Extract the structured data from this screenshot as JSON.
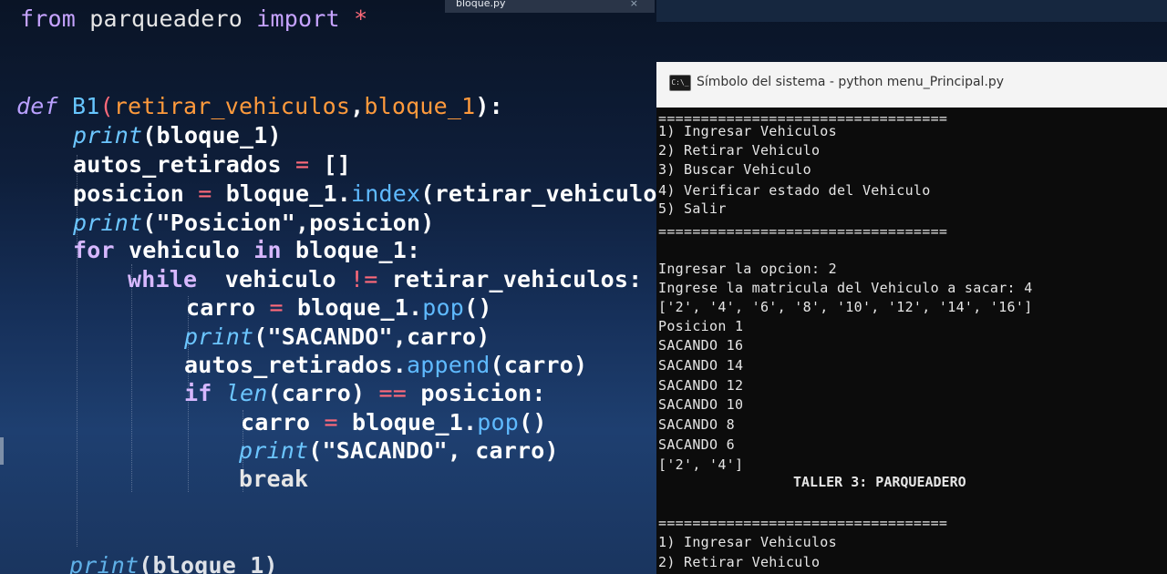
{
  "editor": {
    "tab_label": "bloque.py",
    "tab_close": "×",
    "code": {
      "l1": {
        "a": "from",
        "b": " parqueadero ",
        "c": "import",
        "d": " *"
      },
      "l2": {
        "a": "def",
        "b": " B1",
        "c": "(",
        "d": "retirar_vehiculos",
        "e": ",",
        "f": "bloque_1",
        "g": "):"
      },
      "l3": {
        "a": "print",
        "b": "(bloque_1)"
      },
      "l4": {
        "a": "autos_retirados ",
        "b": "=",
        "c": " []"
      },
      "l5": {
        "a": "posicion ",
        "b": "=",
        "c": " bloque_1.",
        "d": "index",
        "e": "(retirar_vehiculos"
      },
      "l6": {
        "a": "print",
        "b": "(\"Posicion\",posicion)"
      },
      "l7": {
        "a": "for",
        "b": " vehiculo ",
        "c": "in",
        "d": " bloque_1:"
      },
      "l8": {
        "a": "while",
        "b": "  vehiculo ",
        "c": "!=",
        "d": " retirar_vehiculos:"
      },
      "l9": {
        "a": "carro ",
        "b": "=",
        "c": " bloque_1.",
        "d": "pop",
        "e": "()"
      },
      "l10": {
        "a": "print",
        "b": "(\"SACANDO\",carro)"
      },
      "l11": {
        "a": "autos_retirados.",
        "b": "append",
        "c": "(carro)"
      },
      "l12": {
        "a": "if",
        "b": " len",
        "c": "(carro) ",
        "d": "==",
        "e": " posicion:"
      },
      "l13": {
        "a": "carro ",
        "b": "=",
        "c": " bloque_1.",
        "d": "pop",
        "e": "()"
      },
      "l14": {
        "a": "print",
        "b": "(\"SACANDO\", carro)"
      },
      "l15": {
        "a": "break"
      },
      "l16": {
        "a": "print",
        "b": "(bloque_1)"
      }
    }
  },
  "console": {
    "title": "Símbolo del sistema - python  menu_Principal.py",
    "icon_text": "C:\\_",
    "lines": [
      "==================================",
      "1) Ingresar Vehiculos",
      "2) Retirar Vehiculo",
      "3) Buscar Vehiculo",
      "4) Verificar estado del Vehiculo",
      "5) Salir",
      "==================================",
      "",
      "Ingresar la opcion: 2",
      "Ingrese la matricula del Vehiculo a sacar: 4",
      "['2', '4', '6', '8', '10', '12', '14', '16']",
      "Posicion 1",
      "SACANDO 16",
      "SACANDO 14",
      "SACANDO 12",
      "SACANDO 10",
      "SACANDO 8",
      "SACANDO 6",
      "['2', '4']"
    ],
    "banner": "TALLER 3: PARQUEADERO",
    "lines_after": [
      "==================================",
      "1) Ingresar Vehiculos",
      "2) Retirar Vehiculo"
    ]
  }
}
